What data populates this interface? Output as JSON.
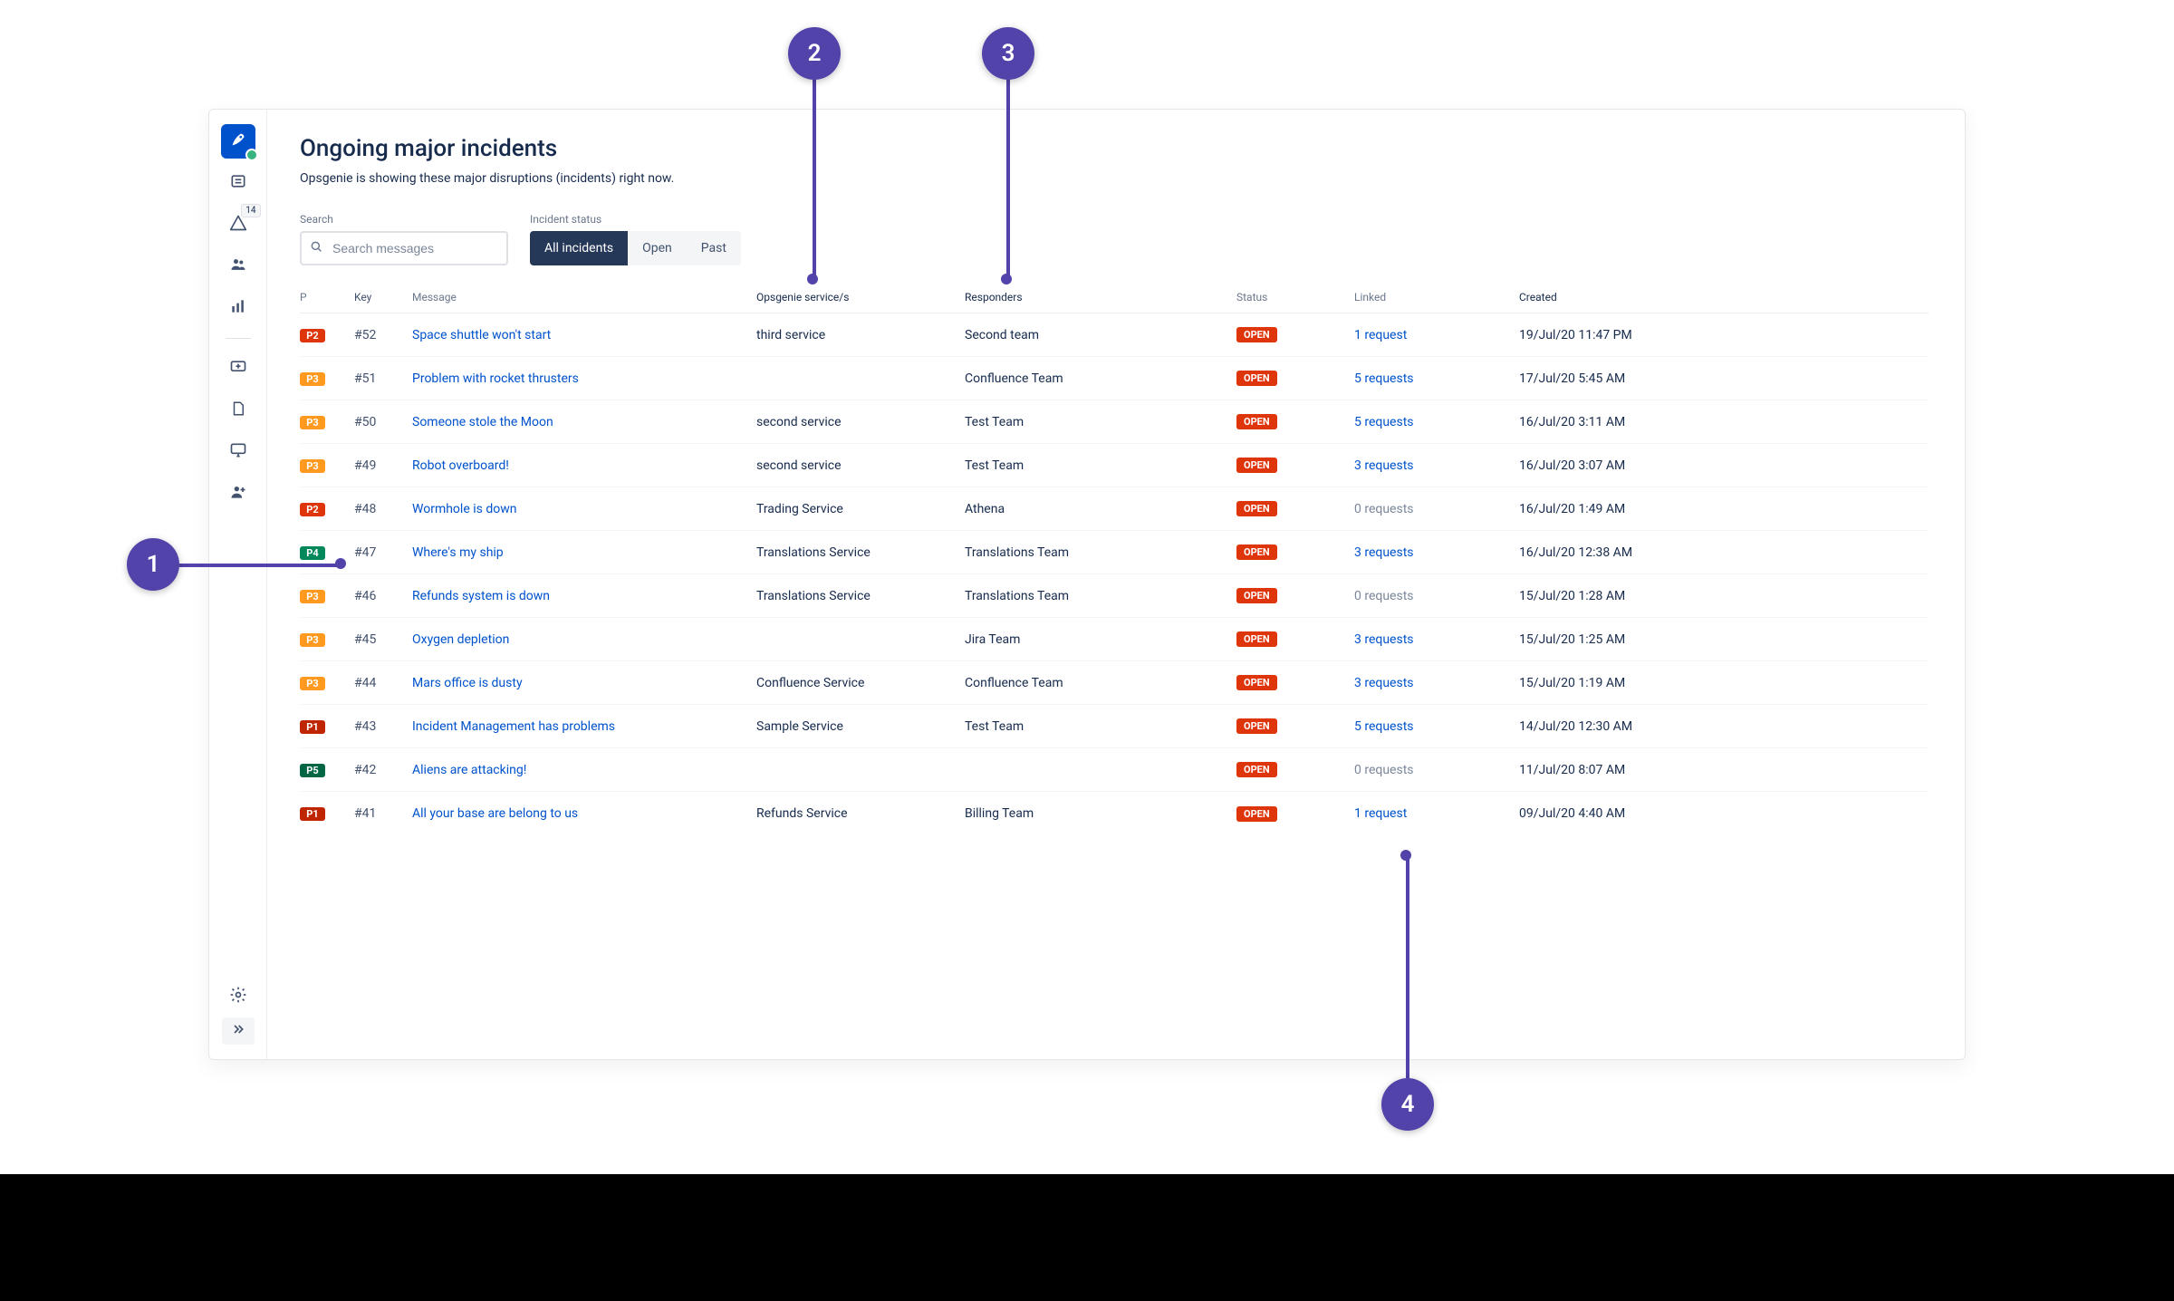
{
  "sidebar": {
    "badge": "14"
  },
  "page": {
    "title": "Ongoing major incidents",
    "subtitle": "Opsgenie is showing these major disruptions (incidents) right now."
  },
  "filters": {
    "search_label": "Search",
    "search_placeholder": "Search messages",
    "status_label": "Incident status",
    "segments": {
      "all": "All incidents",
      "open": "Open",
      "past": "Past"
    }
  },
  "columns": {
    "p": "P",
    "key": "Key",
    "message": "Message",
    "service": "Opsgenie service/s",
    "responders": "Responders",
    "status": "Status",
    "linked": "Linked",
    "created": "Created"
  },
  "status_open": "OPEN",
  "rows": [
    {
      "priority": "P2",
      "key": "#52",
      "message": "Space shuttle won't start",
      "service": "third service",
      "responders": "Second team",
      "linked": "1 request",
      "linked_zero": false,
      "created": "19/Jul/20 11:47 PM"
    },
    {
      "priority": "P3",
      "key": "#51",
      "message": "Problem with rocket thrusters",
      "service": "",
      "responders": "Confluence Team",
      "linked": "5 requests",
      "linked_zero": false,
      "created": "17/Jul/20 5:45 AM"
    },
    {
      "priority": "P3",
      "key": "#50",
      "message": "Someone stole the Moon",
      "service": "second service",
      "responders": "Test Team",
      "linked": "5 requests",
      "linked_zero": false,
      "created": "16/Jul/20 3:11 AM"
    },
    {
      "priority": "P3",
      "key": "#49",
      "message": "Robot overboard!",
      "service": "second service",
      "responders": "Test Team",
      "linked": "3 requests",
      "linked_zero": false,
      "created": "16/Jul/20 3:07 AM"
    },
    {
      "priority": "P2",
      "key": "#48",
      "message": "Wormhole is down",
      "service": "Trading Service",
      "responders": "Athena",
      "linked": "0 requests",
      "linked_zero": true,
      "created": "16/Jul/20 1:49 AM"
    },
    {
      "priority": "P4",
      "key": "#47",
      "message": "Where's my ship",
      "service": "Translations Service",
      "responders": "Translations Team",
      "linked": "3 requests",
      "linked_zero": false,
      "created": "16/Jul/20 12:38 AM"
    },
    {
      "priority": "P3",
      "key": "#46",
      "message": "Refunds system is down",
      "service": "Translations Service",
      "responders": "Translations Team",
      "linked": "0 requests",
      "linked_zero": true,
      "created": "15/Jul/20 1:28 AM"
    },
    {
      "priority": "P3",
      "key": "#45",
      "message": "Oxygen depletion",
      "service": "",
      "responders": "Jira Team",
      "linked": "3 requests",
      "linked_zero": false,
      "created": "15/Jul/20 1:25 AM"
    },
    {
      "priority": "P3",
      "key": "#44",
      "message": "Mars office is dusty",
      "service": "Confluence Service",
      "responders": "Confluence Team",
      "linked": "3 requests",
      "linked_zero": false,
      "created": "15/Jul/20 1:19 AM"
    },
    {
      "priority": "P1",
      "key": "#43",
      "message": "Incident Management has problems",
      "service": "Sample Service",
      "responders": "Test Team",
      "linked": "5 requests",
      "linked_zero": false,
      "created": "14/Jul/20 12:30 AM"
    },
    {
      "priority": "P5",
      "key": "#42",
      "message": "Aliens are attacking!",
      "service": "",
      "responders": "",
      "linked": "0 requests",
      "linked_zero": true,
      "created": "11/Jul/20 8:07 AM"
    },
    {
      "priority": "P1",
      "key": "#41",
      "message": "All your base are belong to us",
      "service": "Refunds Service",
      "responders": "Billing Team",
      "linked": "1 request",
      "linked_zero": false,
      "created": "09/Jul/20 4:40 AM"
    }
  ],
  "callouts": {
    "c1": "1",
    "c2": "2",
    "c3": "3",
    "c4": "4"
  }
}
